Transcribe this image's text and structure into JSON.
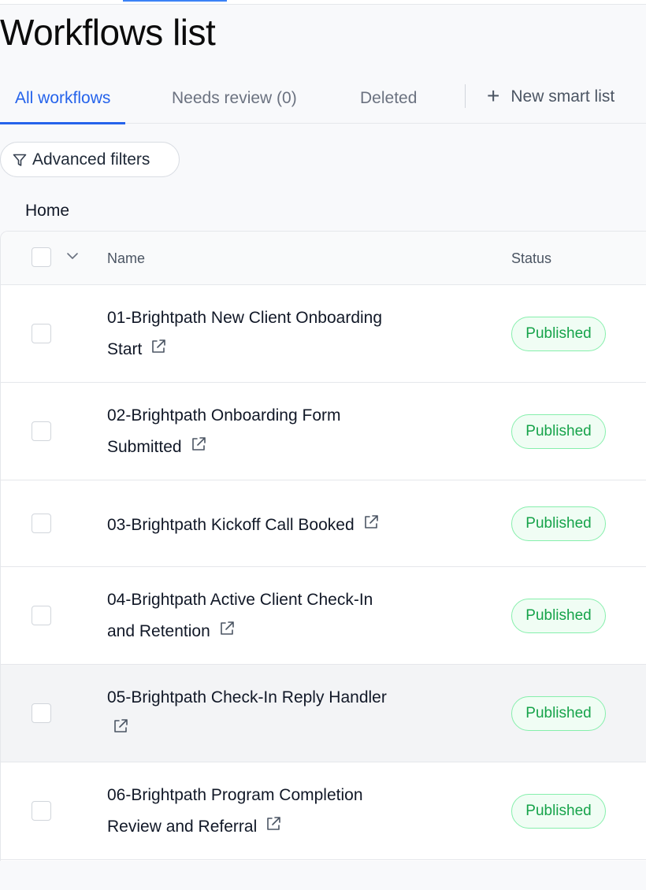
{
  "page": {
    "title": "Workflows list"
  },
  "tabs": [
    {
      "label": "All workflows",
      "active": true
    },
    {
      "label": "Needs review (0)",
      "active": false
    },
    {
      "label": "Deleted",
      "active": false
    }
  ],
  "new_smart_list": {
    "label": "New smart list",
    "icon": "plus-icon"
  },
  "filters": {
    "label": "Advanced filters",
    "icon": "filter-icon"
  },
  "breadcrumb": {
    "label": "Home"
  },
  "table": {
    "columns": {
      "name": "Name",
      "status": "Status"
    },
    "rows": [
      {
        "line1": "01-Brightpath New Client Onboarding",
        "line2": "Start",
        "status": "Published"
      },
      {
        "line1": "02-Brightpath Onboarding Form",
        "line2": "Submitted",
        "status": "Published"
      },
      {
        "line1": "03-Brightpath Kickoff Call Booked",
        "line2": "",
        "status": "Published"
      },
      {
        "line1": "04-Brightpath Active Client Check-In",
        "line2": "and Retention",
        "status": "Published"
      },
      {
        "line1": "05-Brightpath Check-In Reply Handler",
        "line2": "",
        "status": "Published"
      },
      {
        "line1": "06-Brightpath Program Completion",
        "line2": "Review and Referral",
        "status": "Published"
      }
    ]
  },
  "colors": {
    "accent": "#2563eb",
    "published_text": "#16a34a",
    "published_border": "#86efac"
  }
}
